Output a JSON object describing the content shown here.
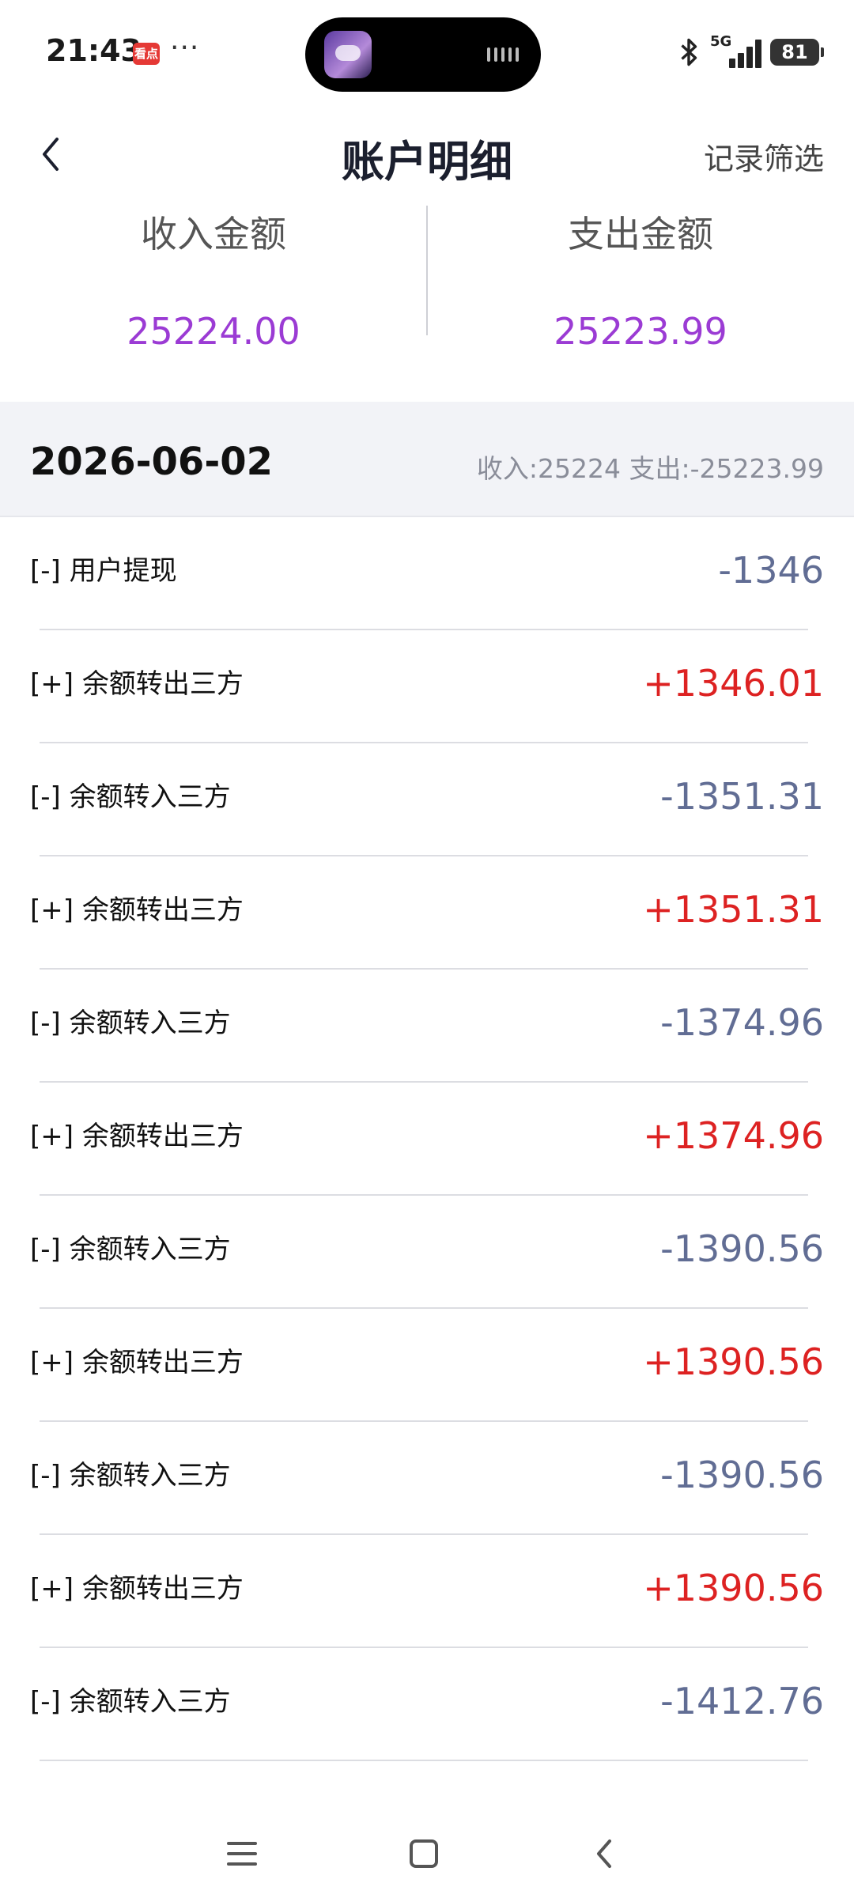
{
  "status_bar": {
    "time": "21:43",
    "badge_text": "看点",
    "dots": "···",
    "network": "5G",
    "battery": "81"
  },
  "header": {
    "title": "账户明细",
    "filter_label": "记录筛选"
  },
  "summary": {
    "income_label": "收入金额",
    "income_value": "25224.00",
    "expense_label": "支出金额",
    "expense_value": "25223.99"
  },
  "date_group": {
    "date": "2026-06-02",
    "totals": "收入:25224  支出:-25223.99"
  },
  "transactions": [
    {
      "label": "[-] 用户提现",
      "amount": "-1346",
      "type": "neg"
    },
    {
      "label": "[+] 余额转出三方",
      "amount": "+1346.01",
      "type": "pos"
    },
    {
      "label": "[-] 余额转入三方",
      "amount": "-1351.31",
      "type": "neg"
    },
    {
      "label": "[+] 余额转出三方",
      "amount": "+1351.31",
      "type": "pos"
    },
    {
      "label": "[-] 余额转入三方",
      "amount": "-1374.96",
      "type": "neg"
    },
    {
      "label": "[+] 余额转出三方",
      "amount": "+1374.96",
      "type": "pos"
    },
    {
      "label": "[-] 余额转入三方",
      "amount": "-1390.56",
      "type": "neg"
    },
    {
      "label": "[+] 余额转出三方",
      "amount": "+1390.56",
      "type": "pos"
    },
    {
      "label": "[-] 余额转入三方",
      "amount": "-1390.56",
      "type": "neg"
    },
    {
      "label": "[+] 余额转出三方",
      "amount": "+1390.56",
      "type": "pos"
    },
    {
      "label": "[-] 余额转入三方",
      "amount": "-1412.76",
      "type": "neg"
    }
  ],
  "colors": {
    "summary_value": "#9b3bd4",
    "negative_amount": "#616d94",
    "positive_amount": "#dd2222",
    "date_row_bg": "#f2f3f7"
  }
}
